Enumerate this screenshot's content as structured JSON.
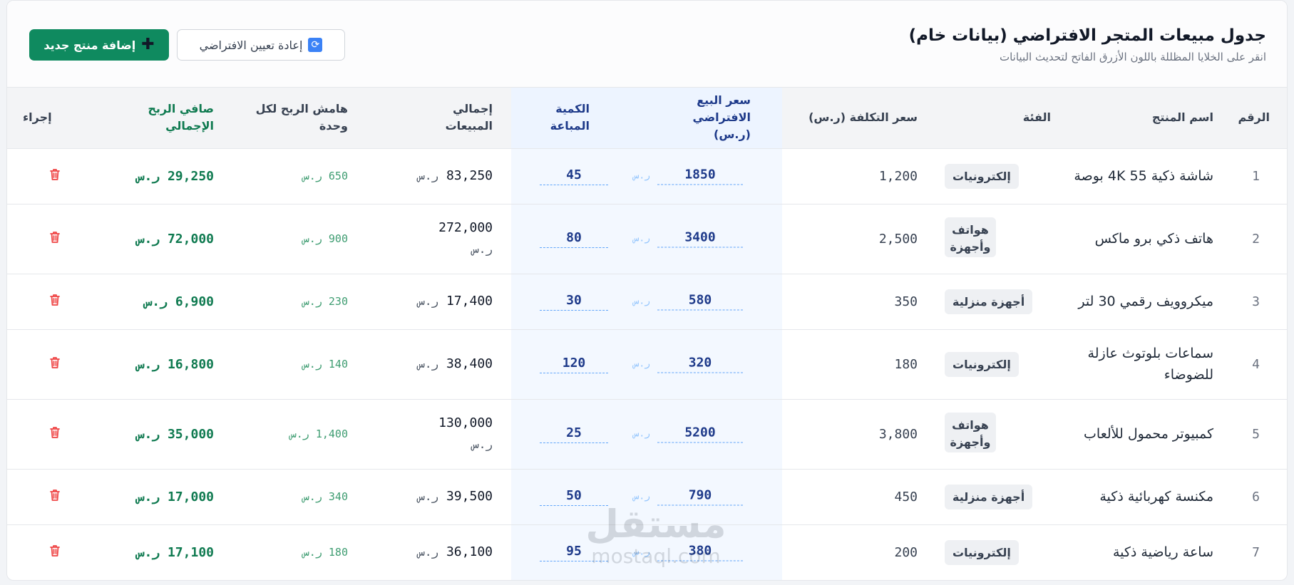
{
  "header": {
    "title": "جدول مبيعات المتجر الافتراضي (بيانات خام)",
    "subtitle": "انقر على الخلايا المظللة باللون الأزرق الفاتح لتحديث البيانات",
    "reset_label": "إعادة تعيين الافتراضي",
    "reset_icon": "refresh-icon",
    "add_label": "إضافة منتج جديد",
    "add_icon": "plus-icon",
    "accent_color": "#0f8a5f"
  },
  "table": {
    "columns": {
      "id": "الرقم",
      "name": "اسم المنتج",
      "category": "الفئة",
      "cost": "سعر التكلفة (ر.س)",
      "price": "سعر البيع الافتراضي (ر.س)",
      "qty": "الكمية المباعة",
      "total": "إجمالي المبيعات",
      "margin": "هامش الربح لكل وحدة",
      "profit": "صافي الربح الإجمالي",
      "action": "إجراء"
    },
    "currency": "ر.س",
    "rows": [
      {
        "id": "1",
        "name": "شاشة ذكية 55 4K بوصة",
        "category": "إلكترونيات",
        "cost": "1,200",
        "price": "1850",
        "qty": "45",
        "total": "83,250",
        "margin": "650",
        "profit": "29,250"
      },
      {
        "id": "2",
        "name": "هاتف ذكي برو ماكس",
        "category": "هواتف وأجهزة",
        "cost": "2,500",
        "price": "3400",
        "qty": "80",
        "total": "272,000",
        "margin": "900",
        "profit": "72,000"
      },
      {
        "id": "3",
        "name": "ميكروويف رقمي 30 لتر",
        "category": "أجهزة منزلية",
        "cost": "350",
        "price": "580",
        "qty": "30",
        "total": "17,400",
        "margin": "230",
        "profit": "6,900"
      },
      {
        "id": "4",
        "name": "سماعات بلوتوث عازلة للضوضاء",
        "category": "إلكترونيات",
        "cost": "180",
        "price": "320",
        "qty": "120",
        "total": "38,400",
        "margin": "140",
        "profit": "16,800"
      },
      {
        "id": "5",
        "name": "كمبيوتر محمول للألعاب",
        "category": "هواتف وأجهزة",
        "cost": "3,800",
        "price": "5200",
        "qty": "25",
        "total": "130,000",
        "margin": "1,400",
        "profit": "35,000"
      },
      {
        "id": "6",
        "name": "مكنسة كهربائية ذكية",
        "category": "أجهزة منزلية",
        "cost": "450",
        "price": "790",
        "qty": "50",
        "total": "39,500",
        "margin": "340",
        "profit": "17,000"
      },
      {
        "id": "7",
        "name": "ساعة رياضية ذكية",
        "category": "إلكترونيات",
        "cost": "200",
        "price": "380",
        "qty": "95",
        "total": "36,100",
        "margin": "180",
        "profit": "17,100"
      }
    ]
  },
  "watermark": {
    "arabic": "مستقل",
    "latin": "mostaql.com"
  }
}
